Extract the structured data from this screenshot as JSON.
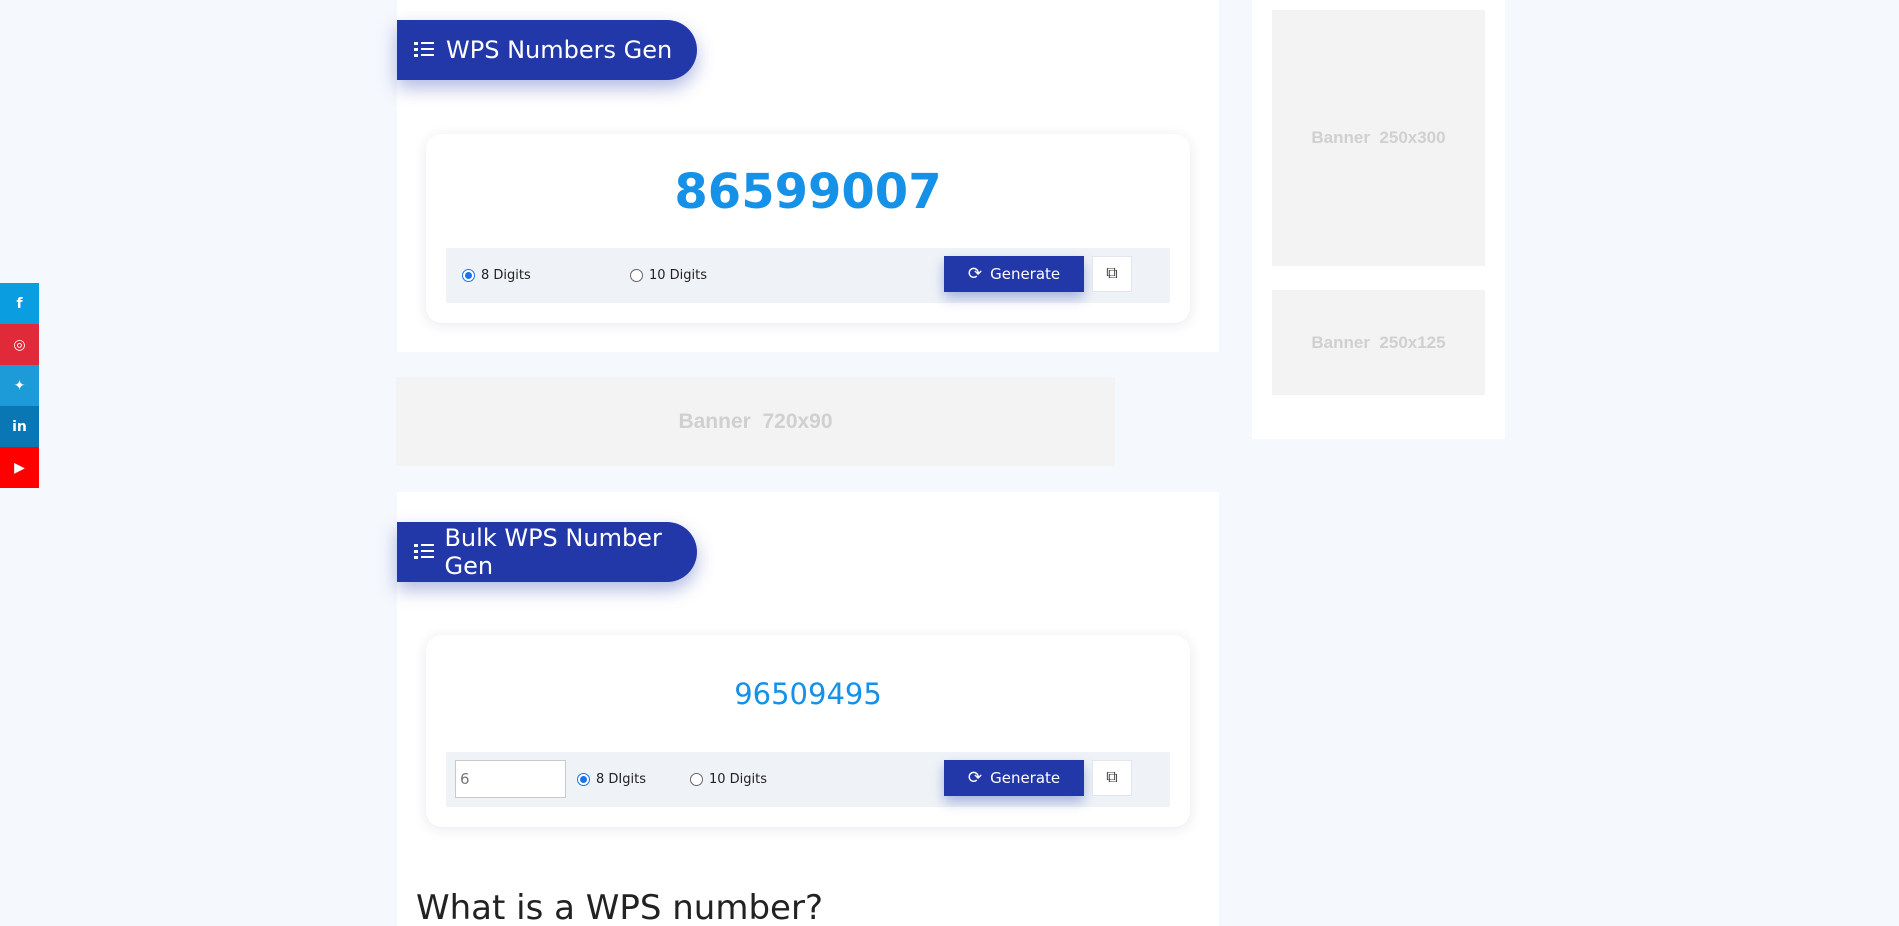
{
  "social": [
    {
      "network": "facebook",
      "glyph": "f",
      "color": "#0a9ee0"
    },
    {
      "network": "instagram",
      "glyph": "◎",
      "color": "#e02a3a"
    },
    {
      "network": "twitter",
      "glyph": "🐦",
      "color": "#1d9bd8"
    },
    {
      "network": "linkedin",
      "glyph": "in",
      "color": "#0a77b5"
    },
    {
      "network": "youtube",
      "glyph": "▶",
      "color": "#ff0000"
    }
  ],
  "single_gen": {
    "title": "WPS Numbers Gen",
    "number": "86599007",
    "option_8": "8 Digits",
    "option_10": "10 Digits",
    "selected": "8 Digits",
    "generate_label": "Generate"
  },
  "bulk_gen": {
    "title": "Bulk WPS Number Gen",
    "number": "96509495",
    "quantity": "6",
    "option_8": "8 DIgits",
    "option_10": "10 Digits",
    "selected": "8 DIgits",
    "generate_label": "Generate"
  },
  "article_heading": "What is a WPS number?",
  "banners": {
    "leaderboard": "Banner  720x90",
    "side_large": "Banner  250x300",
    "side_small": "Banner  250x125"
  },
  "colors": {
    "accent": "#2238a8",
    "number": "#1591e8",
    "bar_bg": "#eff3f8",
    "page_bg": "#f5f8fd"
  }
}
